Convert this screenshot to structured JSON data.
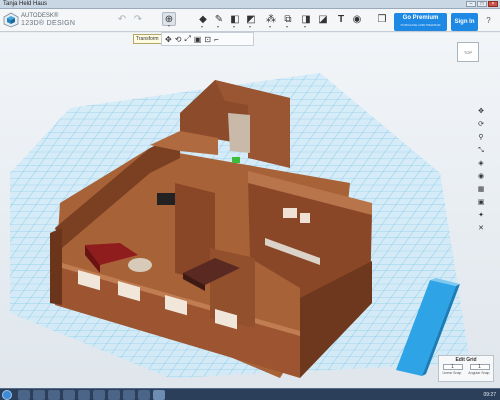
{
  "window": {
    "title": "Tanja Held Haus",
    "controls": [
      "–",
      "□",
      "×"
    ]
  },
  "brand": {
    "line1": "AUTODESK®",
    "line2": "123D® DESIGN"
  },
  "toolbar": {
    "undo_icon": "undo-icon",
    "redo_icon": "redo-icon",
    "tools": [
      "transform",
      "primitives",
      "sketch",
      "construct",
      "modify",
      "pattern",
      "grouping",
      "combine",
      "measure",
      "text",
      "snap",
      "material"
    ],
    "premium_title": "Go Premium",
    "premium_sub": "PURCHASE 123D PREMIUM",
    "signin_label": "Sign In",
    "help_label": "?"
  },
  "transform_tooltip": "Transform",
  "subtools": [
    "move",
    "rotate",
    "scale",
    "align",
    "smart-scale",
    "ruler"
  ],
  "navcube": {
    "face": "TOP"
  },
  "rightnav": [
    "pan",
    "orbit",
    "zoom",
    "fit",
    "view",
    "visibility",
    "grid-view",
    "screenshot",
    "settings",
    "hide"
  ],
  "grid": {
    "title": "Edit Grid",
    "linear_value": "1",
    "angular_value": "1",
    "linear_label": "Linear Snap",
    "angular_label": "Angular Snap"
  },
  "taskbar": {
    "clock": "09:27"
  },
  "colors": {
    "accent": "#1e88e5",
    "grid": "#3aa6d8",
    "wall": "#8a4a2a",
    "floor": "#a8643a"
  }
}
